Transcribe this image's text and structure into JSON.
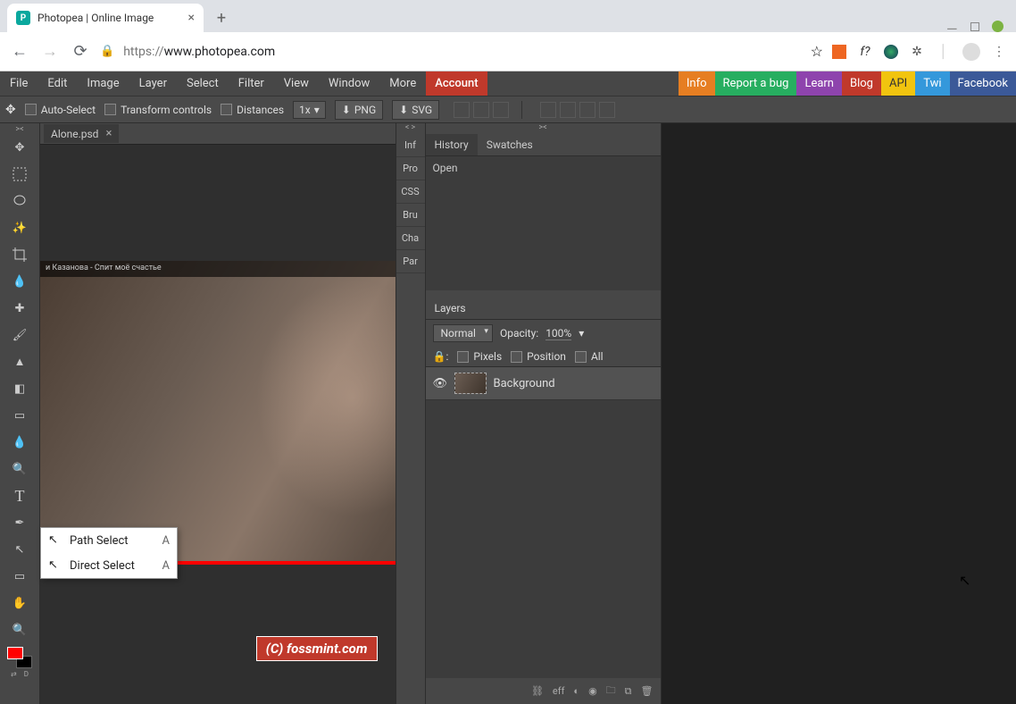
{
  "browser": {
    "tab_title": "Photopea | Online Image",
    "favicon_letter": "P",
    "url_proto": "https://",
    "url_rest": "www.photopea.com",
    "star": "☆"
  },
  "menubar": {
    "items": [
      "File",
      "Edit",
      "Image",
      "Layer",
      "Select",
      "Filter",
      "View",
      "Window",
      "More"
    ],
    "account": "Account",
    "pills": {
      "info": "Info",
      "bug": "Report a bug",
      "learn": "Learn",
      "blog": "Blog",
      "api": "API",
      "twi": "Twi",
      "fb": "Facebook"
    }
  },
  "optbar": {
    "auto_select": "Auto-Select",
    "transform": "Transform controls",
    "distances": "Distances",
    "zoom": "1x",
    "png": "PNG",
    "svg": "SVG"
  },
  "doc": {
    "tab_name": "Alone.psd",
    "vid_caption_left": "и Казанова - Спит моё счастье",
    "watermark": "(C) fossmint.com"
  },
  "ctx_menu": {
    "items": [
      {
        "label": "Path Select",
        "key": "A"
      },
      {
        "label": "Direct Select",
        "key": "A"
      }
    ]
  },
  "gutter_tabs": [
    "Inf",
    "Pro",
    "CSS",
    "Bru",
    "Cha",
    "Par"
  ],
  "panels": {
    "history_tab": "History",
    "swatches_tab": "Swatches",
    "history_entry": "Open",
    "layers_title": "Layers",
    "blend_mode": "Normal",
    "opacity_label": "Opacity:",
    "opacity_value": "100%",
    "lock_pixels": "Pixels",
    "lock_position": "Position",
    "lock_all": "All",
    "layer_name": "Background",
    "footer_eff": "eff"
  }
}
